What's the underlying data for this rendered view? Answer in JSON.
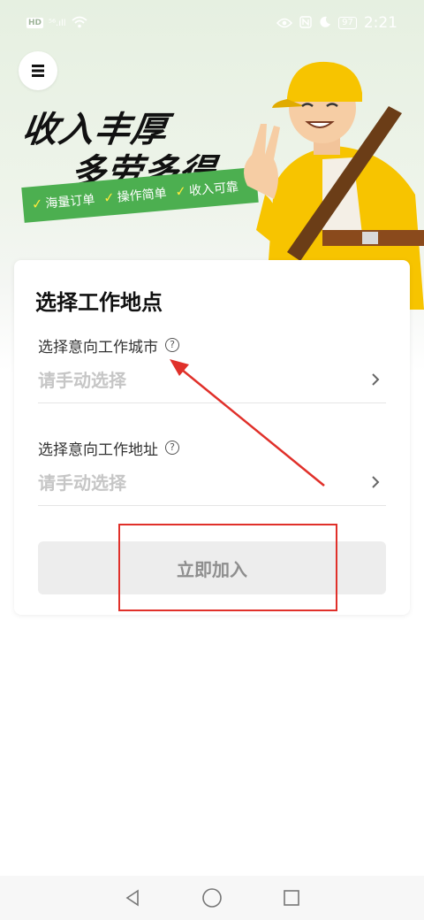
{
  "status_bar": {
    "left_chip": "HD",
    "signal_text": "⁵⁶.ıll",
    "wifi_icon": "wifi-icon",
    "battery": "97",
    "time": "2:21"
  },
  "hero": {
    "title_line1": "收入丰厚",
    "title_line2": "多劳多得",
    "tags": [
      "海量订单",
      "操作简单",
      "收入可靠"
    ],
    "menu_icon": "hamburger-menu-icon"
  },
  "form": {
    "title": "选择工作地点",
    "city_label": "选择意向工作城市",
    "city_value": "请手动选择",
    "address_label": "选择意向工作地址",
    "address_value": "请手动选择",
    "help_glyph": "?",
    "join_label": "立即加入"
  },
  "colors": {
    "accent_green": "#4caf50",
    "annotation_red": "#e0302a",
    "placeholder_gray": "#c6c6c6",
    "disabled_button_bg": "#ededed"
  }
}
